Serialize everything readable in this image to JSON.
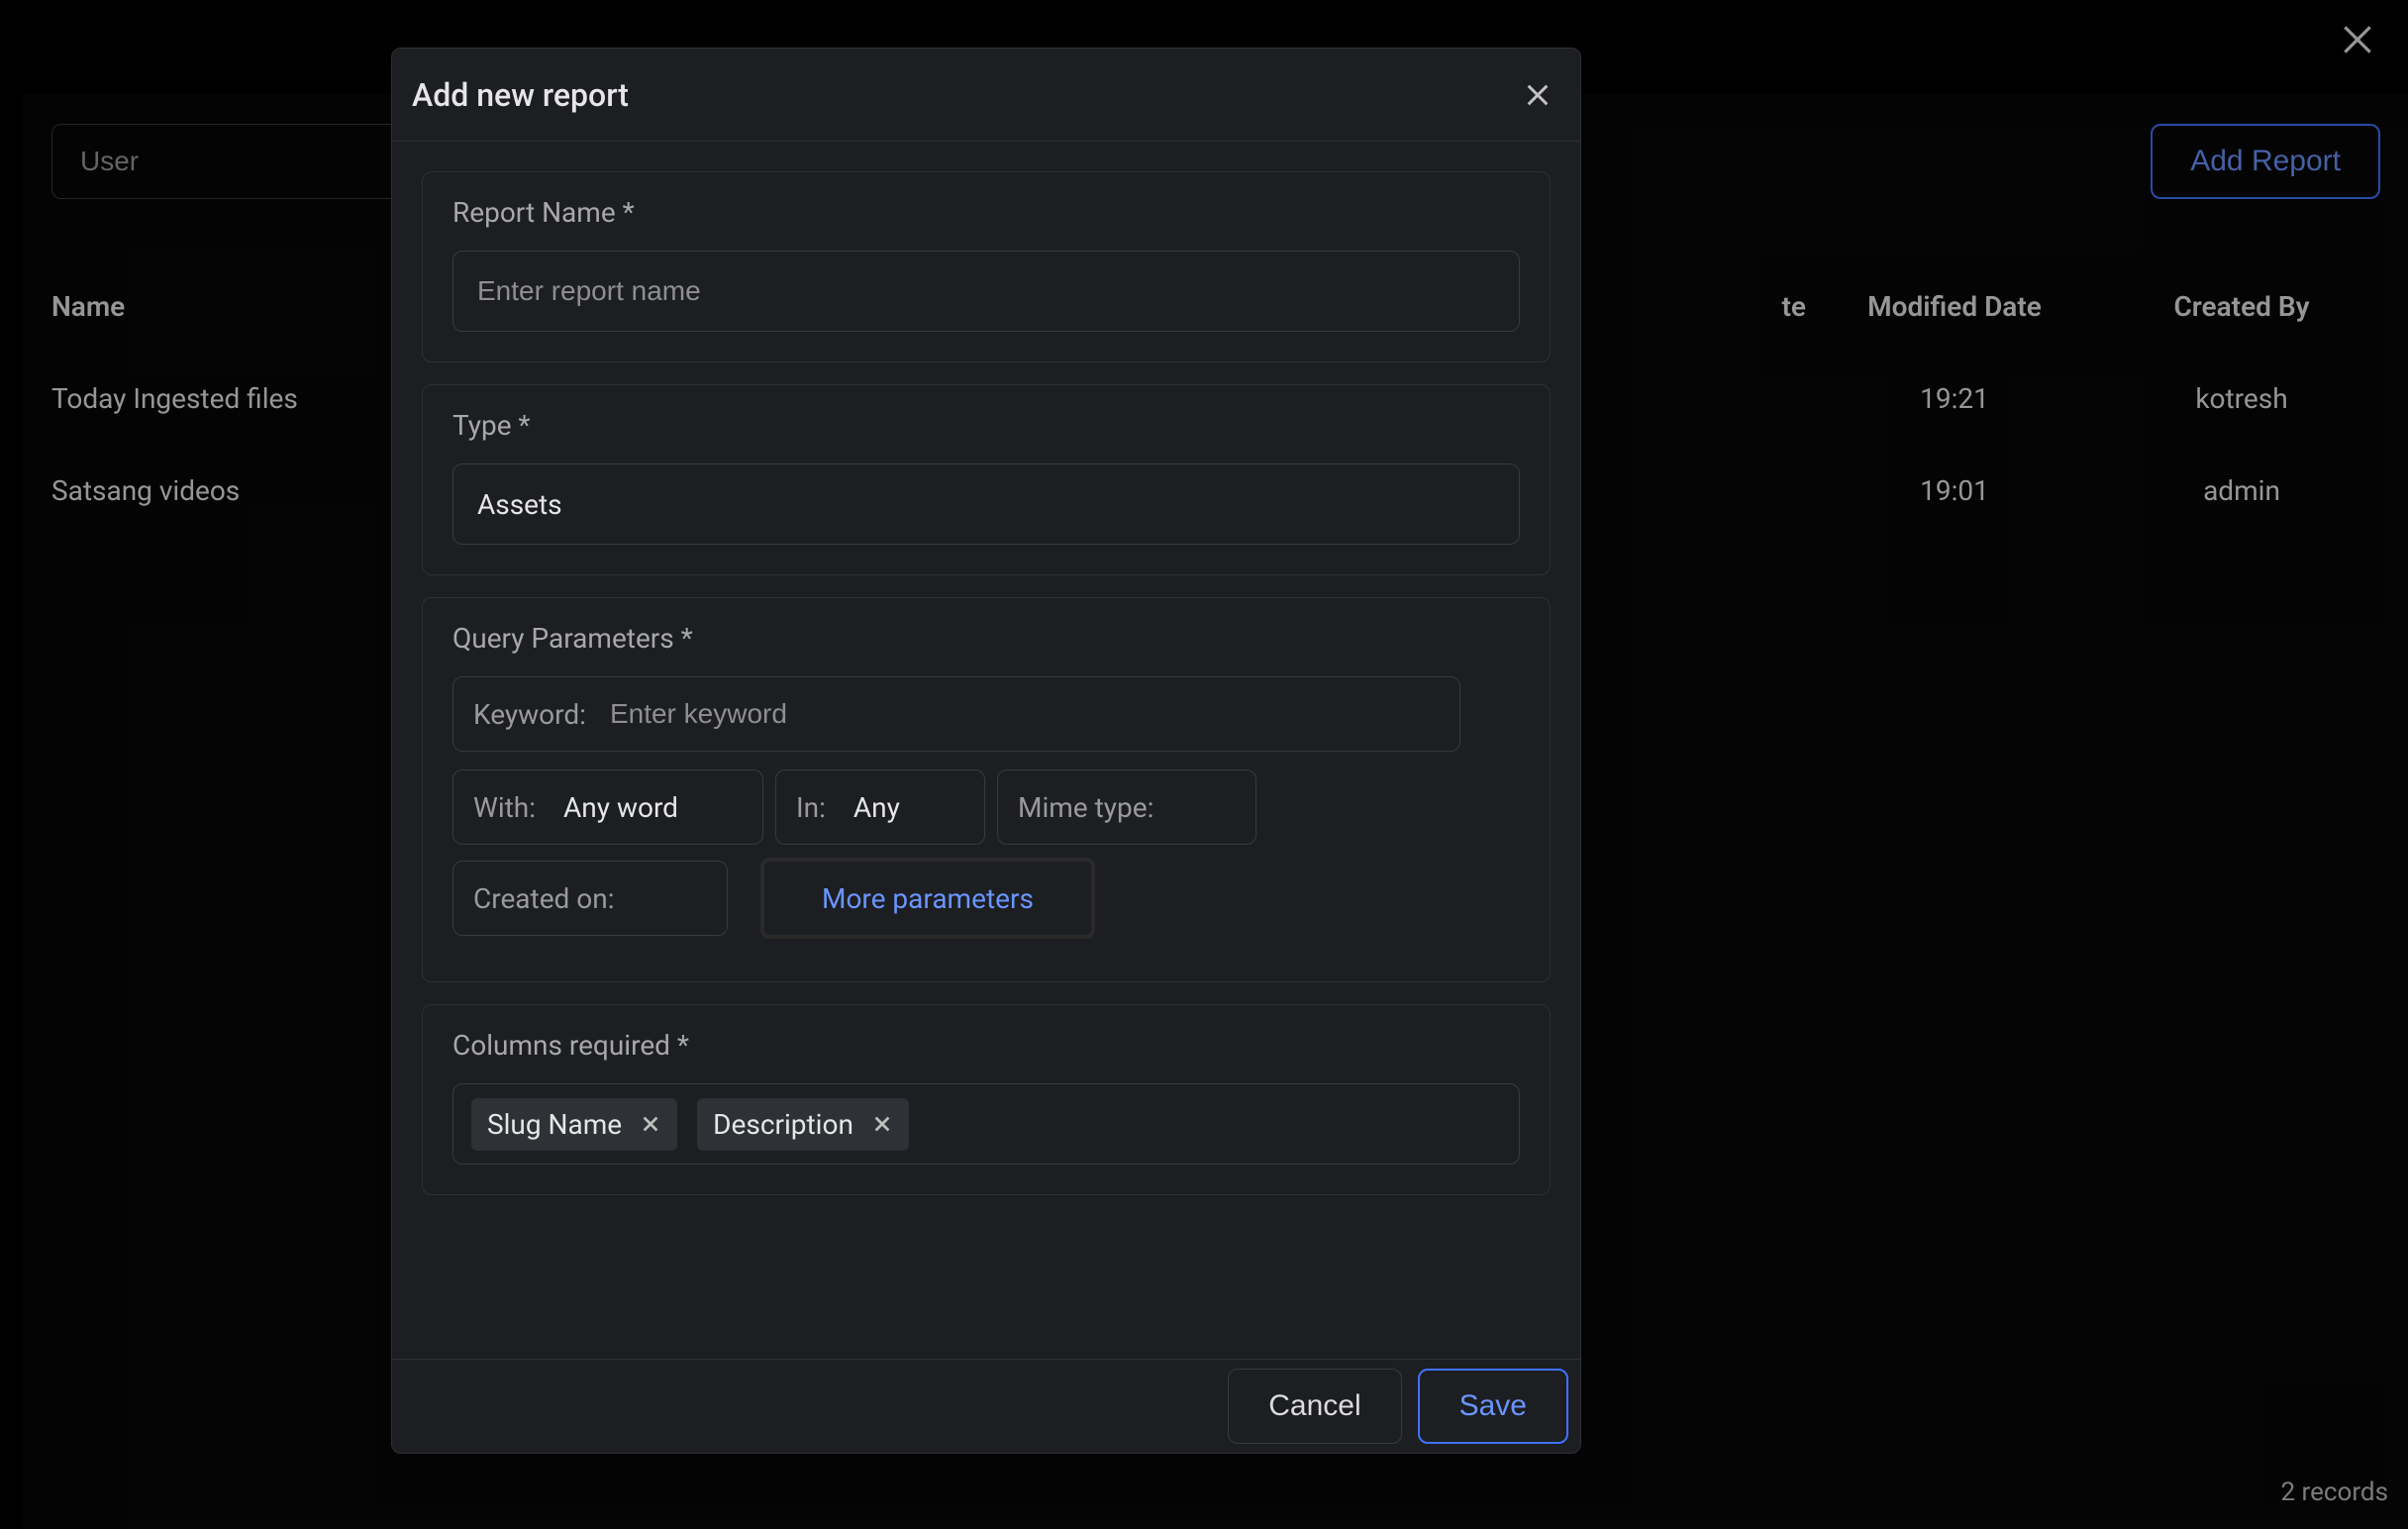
{
  "page": {
    "user_filter_placeholder": "User",
    "add_report_label": "Add Report",
    "footer_records": "2 records",
    "columns": {
      "name": "Name",
      "created_date": "te",
      "modified_date": "Modified Date",
      "created_by": "Created By"
    },
    "rows": [
      {
        "name": "Today Ingested files",
        "modified": "19:21",
        "by": "kotresh"
      },
      {
        "name": "Satsang videos",
        "modified": "19:01",
        "by": "admin"
      }
    ]
  },
  "modal": {
    "title": "Add new report",
    "report_name_label": "Report Name *",
    "report_name_placeholder": "Enter report name",
    "type_label": "Type *",
    "type_value": "Assets",
    "query_label": "Query Parameters *",
    "keyword_label": "Keyword:",
    "keyword_placeholder": "Enter keyword",
    "with_label": "With:",
    "with_value": "Any word",
    "in_label": "In:",
    "in_value": "Any",
    "mime_label": "Mime type:",
    "mime_value": "",
    "created_on_label": "Created on:",
    "created_on_value": "",
    "more_params_label": "More parameters",
    "columns_label": "Columns required *",
    "tags": [
      {
        "label": "Slug Name"
      },
      {
        "label": "Description"
      }
    ],
    "cancel_label": "Cancel",
    "save_label": "Save"
  }
}
